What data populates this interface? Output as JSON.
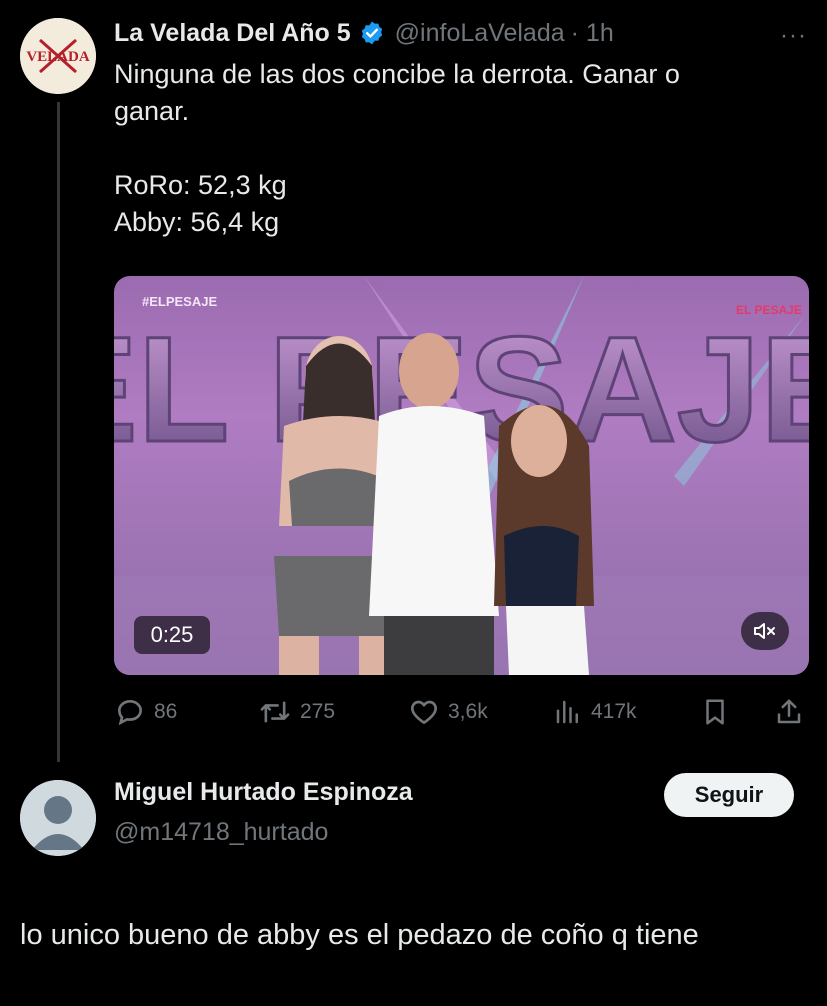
{
  "tweet": {
    "author_name": "La Velada Del Año 5",
    "author_handle": "@infoLaVelada",
    "time": "· 1h",
    "more_label": "···",
    "avatar_logo_text": "VELADA",
    "text_lines": [
      "Ninguna de las dos concibe la derrota. Ganar o",
      "ganar."
    ],
    "weights": [
      "RoRo: 52,3 kg",
      "Abby: 56,4 kg"
    ],
    "video": {
      "banner_text": "EL PESAJE",
      "hashtag": "#ELPESAJE",
      "corner_logo": "EL PESAJE",
      "duration": "0:25"
    },
    "actions": {
      "replies": "86",
      "retweets": "275",
      "likes": "3,6k",
      "views": "417k"
    }
  },
  "reply": {
    "author_name": "Miguel Hurtado Espinoza",
    "author_handle": "@m14718_hurtado",
    "follow_label": "Seguir",
    "text": "lo unico bueno de abby es el pedazo de coño q tiene"
  },
  "colors": {
    "background": "#000000",
    "text": "#e7e9ea",
    "muted": "#71767b",
    "verified_blue": "#1d9bf0",
    "follow_button": "#eff3f4"
  }
}
